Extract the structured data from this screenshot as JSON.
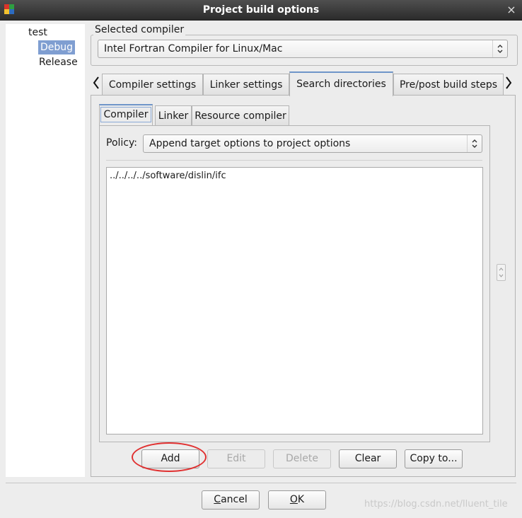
{
  "window": {
    "title": "Project build options",
    "close_glyph": "×"
  },
  "tree": {
    "items": [
      "test",
      "Debug",
      "Release"
    ],
    "selected": "Debug"
  },
  "compiler": {
    "legend": "Selected compiler",
    "selected": "Intel Fortran Compiler for Linux/Mac"
  },
  "outer_tabs": {
    "items": [
      "Compiler settings",
      "Linker settings",
      "Search directories",
      "Pre/post build steps"
    ],
    "active": "Search directories"
  },
  "inner_tabs": {
    "items": [
      "Compiler",
      "Linker",
      "Resource compiler"
    ],
    "active": "Compiler"
  },
  "policy": {
    "label": "Policy:",
    "selected": "Append target options to project options"
  },
  "directories": [
    "../../../../software/dislin/ifc"
  ],
  "buttons": {
    "add": "Add",
    "edit": "Edit",
    "delete": "Delete",
    "clear": "Clear",
    "copy_to": "Copy to..."
  },
  "footer": {
    "cancel_mnemonic": "C",
    "cancel_rest": "ancel",
    "ok_mnemonic": "O",
    "ok_rest": "K"
  },
  "watermark": "https://blog.csdn.net/lluent_tile",
  "colors": {
    "selection": "#7f9ed1",
    "tab_accent": "#6f95c9",
    "highlight_circle": "#e03030"
  },
  "icons": [
    "app-icon",
    "close-icon",
    "chevron-left-icon",
    "chevron-right-icon",
    "combo-arrows-icon",
    "spin-icon"
  ]
}
